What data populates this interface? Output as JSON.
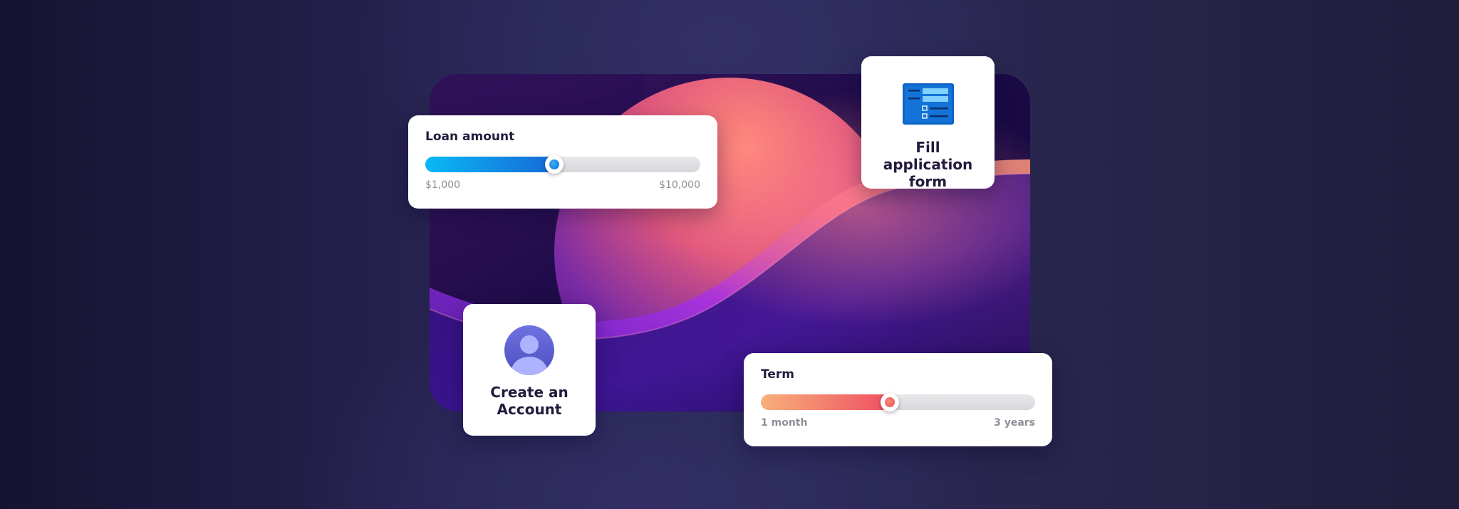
{
  "loan_slider": {
    "label": "Loan amount",
    "min_label": "$1,000",
    "max_label": "$10,000",
    "value_fraction": 0.47
  },
  "term_slider": {
    "label": "Term",
    "min_label": "1 month",
    "max_label": "3 years",
    "value_fraction": 0.47
  },
  "steps": {
    "fill_form": {
      "title": "Fill application form",
      "icon": "form-document-icon"
    },
    "create_account": {
      "title": "Create an Account",
      "icon": "user-avatar-icon"
    }
  },
  "colors": {
    "background": "#231f48",
    "card": "#ffffff",
    "loan_fill_start": "#09b9f5",
    "loan_fill_end": "#1769d6",
    "term_fill_start": "#f7b07a",
    "term_fill_end": "#ef4f63",
    "text_dark": "#241b3d",
    "text_muted": "#8d8d99"
  }
}
